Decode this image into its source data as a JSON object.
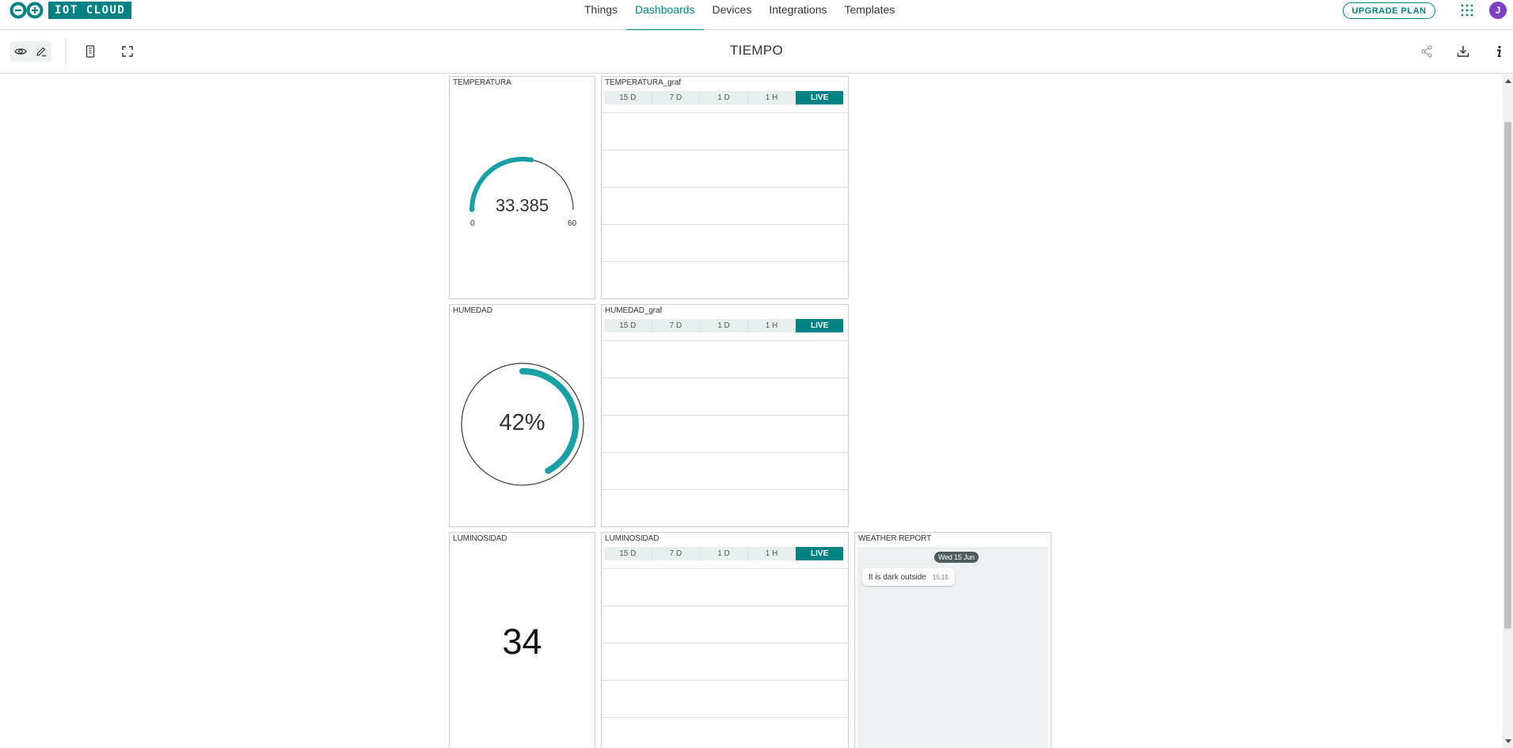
{
  "app": {
    "logo_text": "IOT CLOUD",
    "upgrade_label": "UPGRADE PLAN",
    "avatar_initial": "J",
    "accent_color": "#008184"
  },
  "nav": {
    "items": [
      {
        "label": "Things"
      },
      {
        "label": "Dashboards",
        "active": true
      },
      {
        "label": "Devices"
      },
      {
        "label": "Integrations"
      },
      {
        "label": "Templates"
      }
    ]
  },
  "toolbar": {
    "title": "TIEMPO",
    "icons": [
      "eye-icon",
      "pencil-icon",
      "mobile-icon",
      "fullscreen-icon",
      "share-icon",
      "download-icon",
      "info-icon"
    ]
  },
  "widgets": {
    "temperatura": {
      "title": "TEMPERATURA",
      "value": "33.385",
      "min": "0",
      "max": "60",
      "fraction": 0.556
    },
    "temperatura_graf": {
      "title": "TEMPERATURA_graf"
    },
    "humedad": {
      "title": "HUMEDAD",
      "value": "42%",
      "fraction": 0.42
    },
    "humedad_graf": {
      "title": "HUMEDAD_graf"
    },
    "luminosidad": {
      "title": "LUMINOSIDAD",
      "value": "34"
    },
    "luminosidad_graf": {
      "title": "LUMINOSIDAD"
    },
    "weather": {
      "title": "WEATHER REPORT",
      "date": "Wed 15 Jun",
      "message": "It is dark outside",
      "time": "15:15"
    }
  },
  "ranges": [
    "15 D",
    "7 D",
    "1 D",
    "1 H",
    "LIVE"
  ]
}
